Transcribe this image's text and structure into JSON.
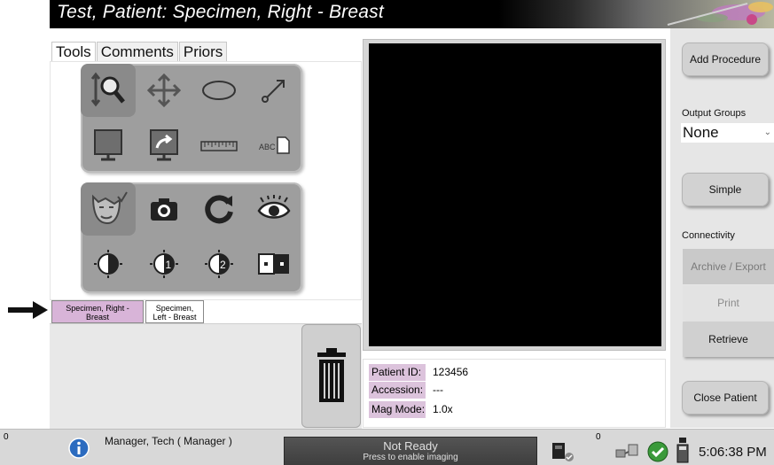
{
  "window": {
    "title": "Test, Patient:  Specimen, Right - Breast"
  },
  "left_panel": {
    "tabs": [
      {
        "label": "Tools",
        "active": true
      },
      {
        "label": "Comments",
        "active": false
      },
      {
        "label": "Priors",
        "active": false
      }
    ],
    "tool_icons_group1": [
      "zoom-icon",
      "pan-icon",
      "ellipse-icon",
      "line-arrow-icon",
      "monitor-icon",
      "export-image-icon",
      "ruler-icon",
      "text-annotation-icon"
    ],
    "tool_annotation_label": "ABC",
    "tool_icons_group2": [
      "face-check-icon",
      "camera-icon",
      "refresh-icon",
      "eye-icon",
      "contrast-icon",
      "contrast-1-icon",
      "contrast-2-icon",
      "stitch-icon"
    ],
    "contrast_1_label": "1",
    "contrast_2_label": "2",
    "studies": [
      {
        "label": "Specimen, Right - Breast",
        "selected": true
      },
      {
        "label": "Specimen, Left - Breast",
        "selected": false
      }
    ]
  },
  "info_panel": {
    "patient_id_label": "Patient ID:",
    "patient_id_value": "123456",
    "accession_label": "Accession:",
    "accession_value": "---",
    "mag_mode_label": "Mag Mode:",
    "mag_mode_value": "1.0x"
  },
  "right_panel": {
    "add_procedure": "Add Procedure",
    "output_groups_label": "Output Groups",
    "output_groups_value": "None",
    "simple": "Simple",
    "connectivity_label": "Connectivity",
    "archive_export": "Archive / Export",
    "print": "Print",
    "retrieve": "Retrieve",
    "close_patient": "Close Patient"
  },
  "status_bar": {
    "alerts_count": "0",
    "user": "Manager, Tech ( Manager )",
    "status_title": "Not Ready",
    "status_sub": "Press to enable imaging",
    "queue_count": "0",
    "clock": "5:06:38 PM"
  }
}
